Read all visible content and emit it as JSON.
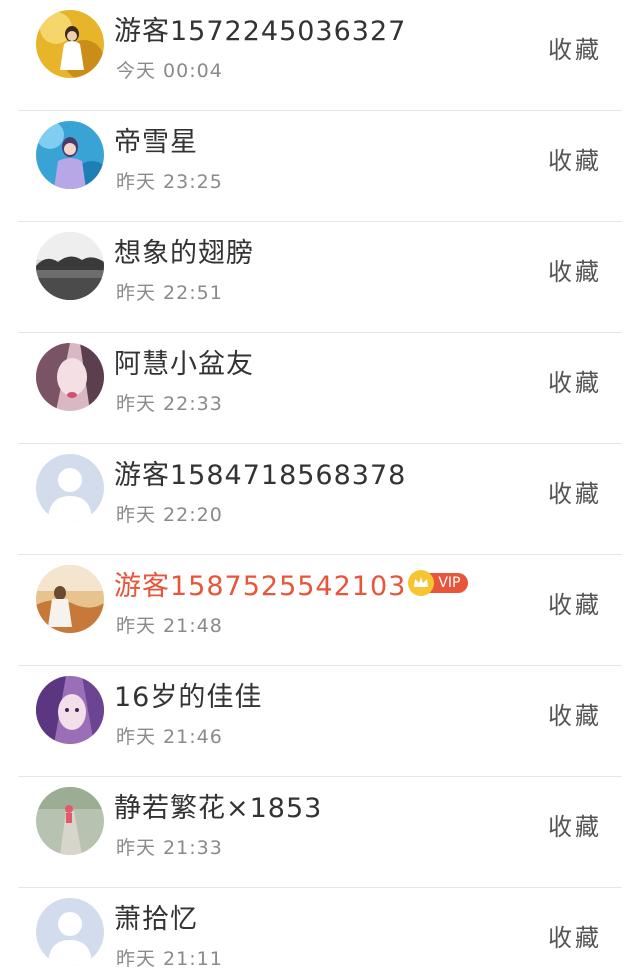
{
  "items": [
    {
      "name": "游客1572245036327",
      "time": "今天 00:04",
      "action": "收藏",
      "avatar": "photo-girl-yellow",
      "vip": false
    },
    {
      "name": "帝雪星",
      "time": "昨天 23:25",
      "action": "收藏",
      "avatar": "photo-blue-water",
      "vip": false
    },
    {
      "name": "想象的翅膀",
      "time": "昨天 22:51",
      "action": "收藏",
      "avatar": "photo-landscape-gray",
      "vip": false
    },
    {
      "name": "阿慧小盆友",
      "time": "昨天 22:33",
      "action": "收藏",
      "avatar": "photo-face-pink",
      "vip": false
    },
    {
      "name": "游客1584718568378",
      "time": "昨天 22:20",
      "action": "收藏",
      "avatar": "default-person",
      "vip": false
    },
    {
      "name": "游客1587525542103",
      "time": "昨天 21:48",
      "action": "收藏",
      "avatar": "photo-field-orange",
      "vip": true,
      "vip_label": "VIP"
    },
    {
      "name": "16岁的佳佳",
      "time": "昨天 21:46",
      "action": "收藏",
      "avatar": "photo-anime-purple",
      "vip": false
    },
    {
      "name": "静若繁花×1853",
      "time": "昨天 21:33",
      "action": "收藏",
      "avatar": "photo-road-green",
      "vip": false
    },
    {
      "name": "萧拾忆",
      "time": "昨天 21:11",
      "action": "收藏",
      "avatar": "default-person",
      "vip": false
    }
  ],
  "colors": {
    "vip_name": "#e8553a",
    "vip_badge": "#e8553a",
    "crown": "#f7c531",
    "name": "#333333",
    "time": "#8a8a8a",
    "divider": "#e6e6e6"
  }
}
